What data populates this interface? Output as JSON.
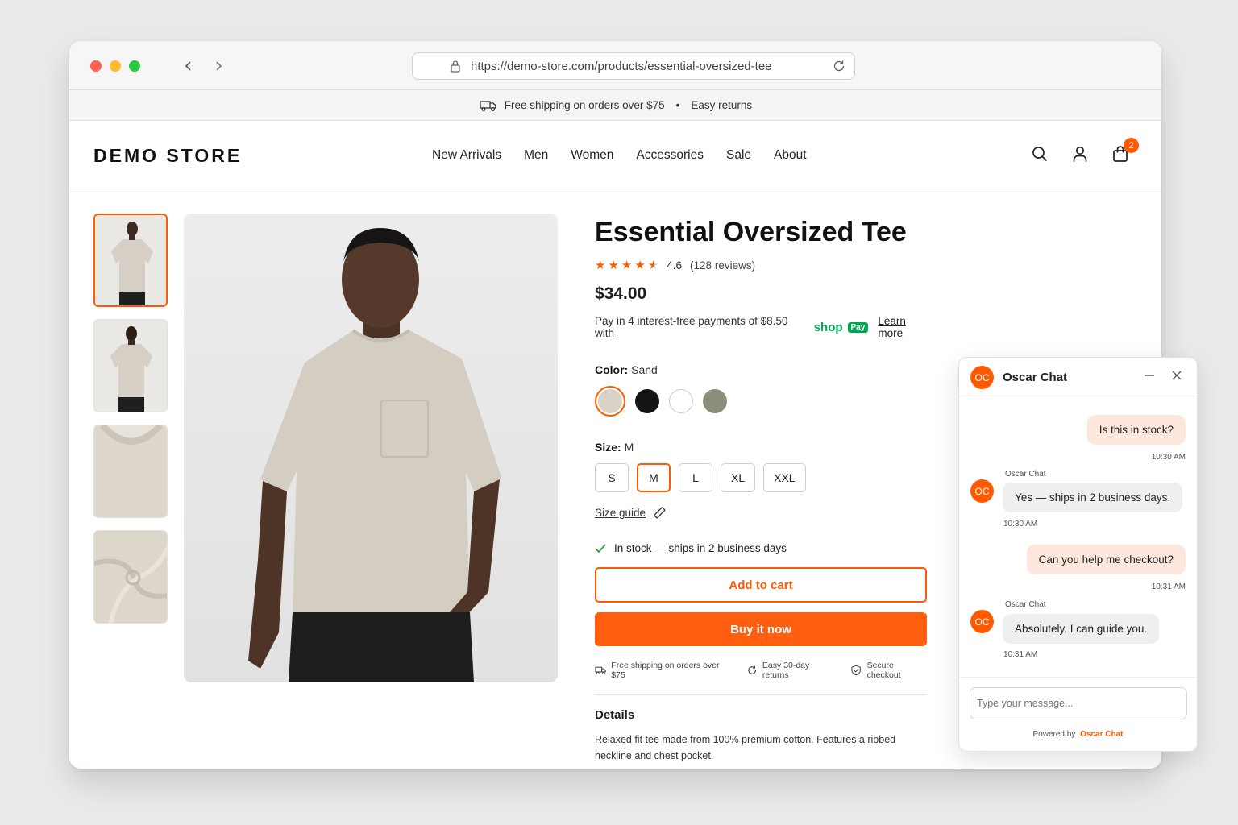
{
  "browser": {
    "url": "https://demo-store.com/products/essential-oversized-tee"
  },
  "promo": {
    "shipping": "Free shipping on orders over $75",
    "separator": "•",
    "returns": "Easy returns"
  },
  "header": {
    "logo": "DEMO STORE",
    "nav": [
      "New Arrivals",
      "Men",
      "Women",
      "Accessories",
      "Sale",
      "About"
    ],
    "cart_count": "2",
    "search_icon": "search-icon",
    "account_icon": "user-icon",
    "cart_icon": "shopping-bag-icon"
  },
  "product": {
    "title": "Essential Oversized Tee",
    "rating": 4.6,
    "rating_text": "4.6",
    "reviews": "(128 reviews)",
    "price": "$34.00",
    "installments": "Pay in 4 interest-free payments of $8.50 with",
    "shop_word": "shop",
    "pay_word": "Pay",
    "learn_more": "Learn more",
    "color_label": "Color:",
    "color_value": "Sand",
    "colors": [
      "#d8d2c7",
      "#141414",
      "#ffffff",
      "#8a8f7a"
    ],
    "size_label": "Size:",
    "size_value": "M",
    "sizes": [
      "S",
      "M",
      "L",
      "XL",
      "XXL"
    ],
    "selected_size": "M",
    "size_guide": "Size guide",
    "stock": "In stock — ships in 2 business days",
    "add_to_cart": "Add to cart",
    "buy_now": "Buy it now",
    "perks": [
      "Free shipping on orders over $75",
      "Easy 30-day returns",
      "Secure checkout"
    ],
    "details_heading": "Details",
    "details_text": "Relaxed fit tee made from 100% premium cotton. Features a ribbed neckline and chest pocket."
  },
  "chat": {
    "avatar": "OC",
    "title": "Oscar Chat",
    "messages": [
      {
        "from": "user",
        "text": "Is this in stock?",
        "time": "10:30 AM"
      },
      {
        "from": "bot",
        "sender": "Oscar Chat",
        "text": "Yes — ships in 2 business days.",
        "time": "10:30 AM"
      },
      {
        "from": "user",
        "text": "Can you help me checkout?",
        "time": "10:31 AM"
      },
      {
        "from": "bot",
        "sender": "Oscar Chat",
        "text": "Absolutely, I can guide you.",
        "time": "10:31 AM"
      }
    ],
    "input_placeholder": "Type your message...",
    "powered_by": "Powered by",
    "powered_brand": "Oscar Chat"
  },
  "colors": {
    "accent": "#ff5a00",
    "shop_green": "#00a650"
  }
}
